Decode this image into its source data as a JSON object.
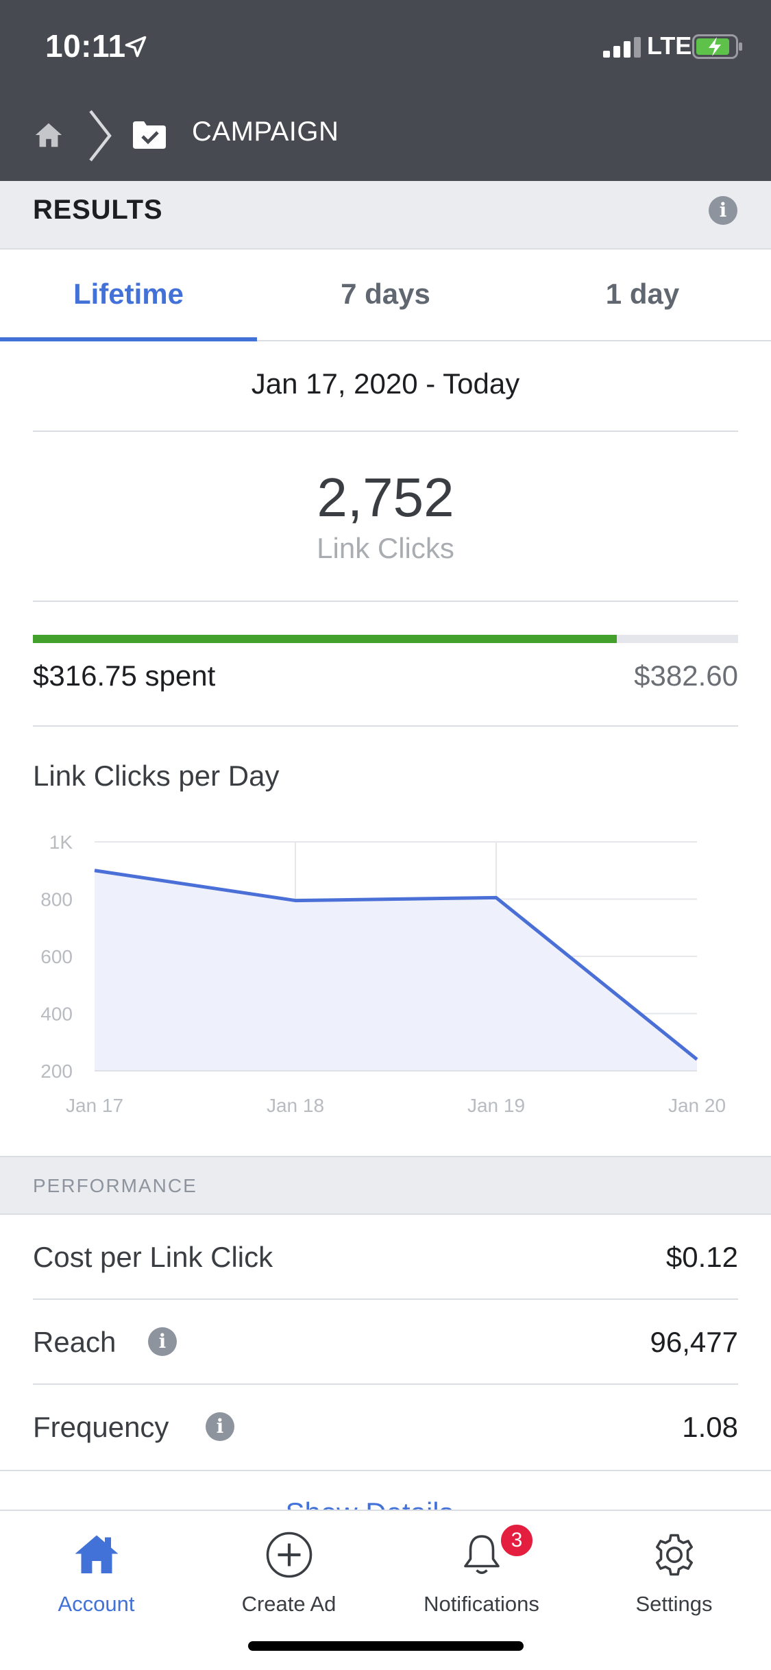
{
  "status_bar": {
    "time": "10:11",
    "network": "LTE",
    "icons": [
      "location-arrow-icon",
      "signal-icon",
      "battery-charging-icon"
    ]
  },
  "nav": {
    "title": "CAMPAIGN",
    "icons": [
      "home-icon",
      "chevron-right-icon",
      "campaign-folder-icon"
    ]
  },
  "results": {
    "title": "RESULTS",
    "tabs": [
      {
        "label": "Lifetime",
        "active": true
      },
      {
        "label": "7 days",
        "active": false
      },
      {
        "label": "1 day",
        "active": false
      }
    ],
    "date_range": "Jan 17, 2020 - Today",
    "metric_value": "2,752",
    "metric_label": "Link Clicks",
    "spent_amount": "$316.75",
    "spent_suffix": "spent",
    "budget": "$382.60",
    "spent_fraction": 0.828,
    "progress_color": "#43a02b"
  },
  "chart_title": "Link Clicks per Day",
  "chart_data": {
    "type": "area",
    "title": "",
    "xlabel": "",
    "ylabel": "",
    "categories": [
      "Jan 17",
      "Jan 18",
      "Jan 19",
      "Jan 20"
    ],
    "values": [
      900,
      795,
      805,
      240
    ],
    "y_ticks": [
      "1K",
      "800",
      "600",
      "400",
      "200"
    ],
    "y_tick_values": [
      1000,
      800,
      600,
      400,
      200
    ],
    "ylim": [
      200,
      1000
    ],
    "grid": true,
    "line_color": "#4a6fd6",
    "fill_color": "#eef0fb"
  },
  "performance": {
    "title": "PERFORMANCE",
    "rows": [
      {
        "label": "Cost per Link Click",
        "value": "$0.12",
        "info": false
      },
      {
        "label": "Reach",
        "value": "96,477",
        "info": true
      },
      {
        "label": "Frequency",
        "value": "1.08",
        "info": true
      }
    ],
    "show_details": "Show Details"
  },
  "tabbar": {
    "items": [
      {
        "label": "Account",
        "icon": "home-icon",
        "active": true
      },
      {
        "label": "Create Ad",
        "icon": "plus-circle-icon",
        "active": false
      },
      {
        "label": "Notifications",
        "icon": "bell-icon",
        "active": false,
        "badge": "3"
      },
      {
        "label": "Settings",
        "icon": "gear-icon",
        "active": false
      }
    ]
  },
  "colors": {
    "accent": "#4271d8",
    "header_bg": "#474a51",
    "badge": "#e41e3f"
  }
}
